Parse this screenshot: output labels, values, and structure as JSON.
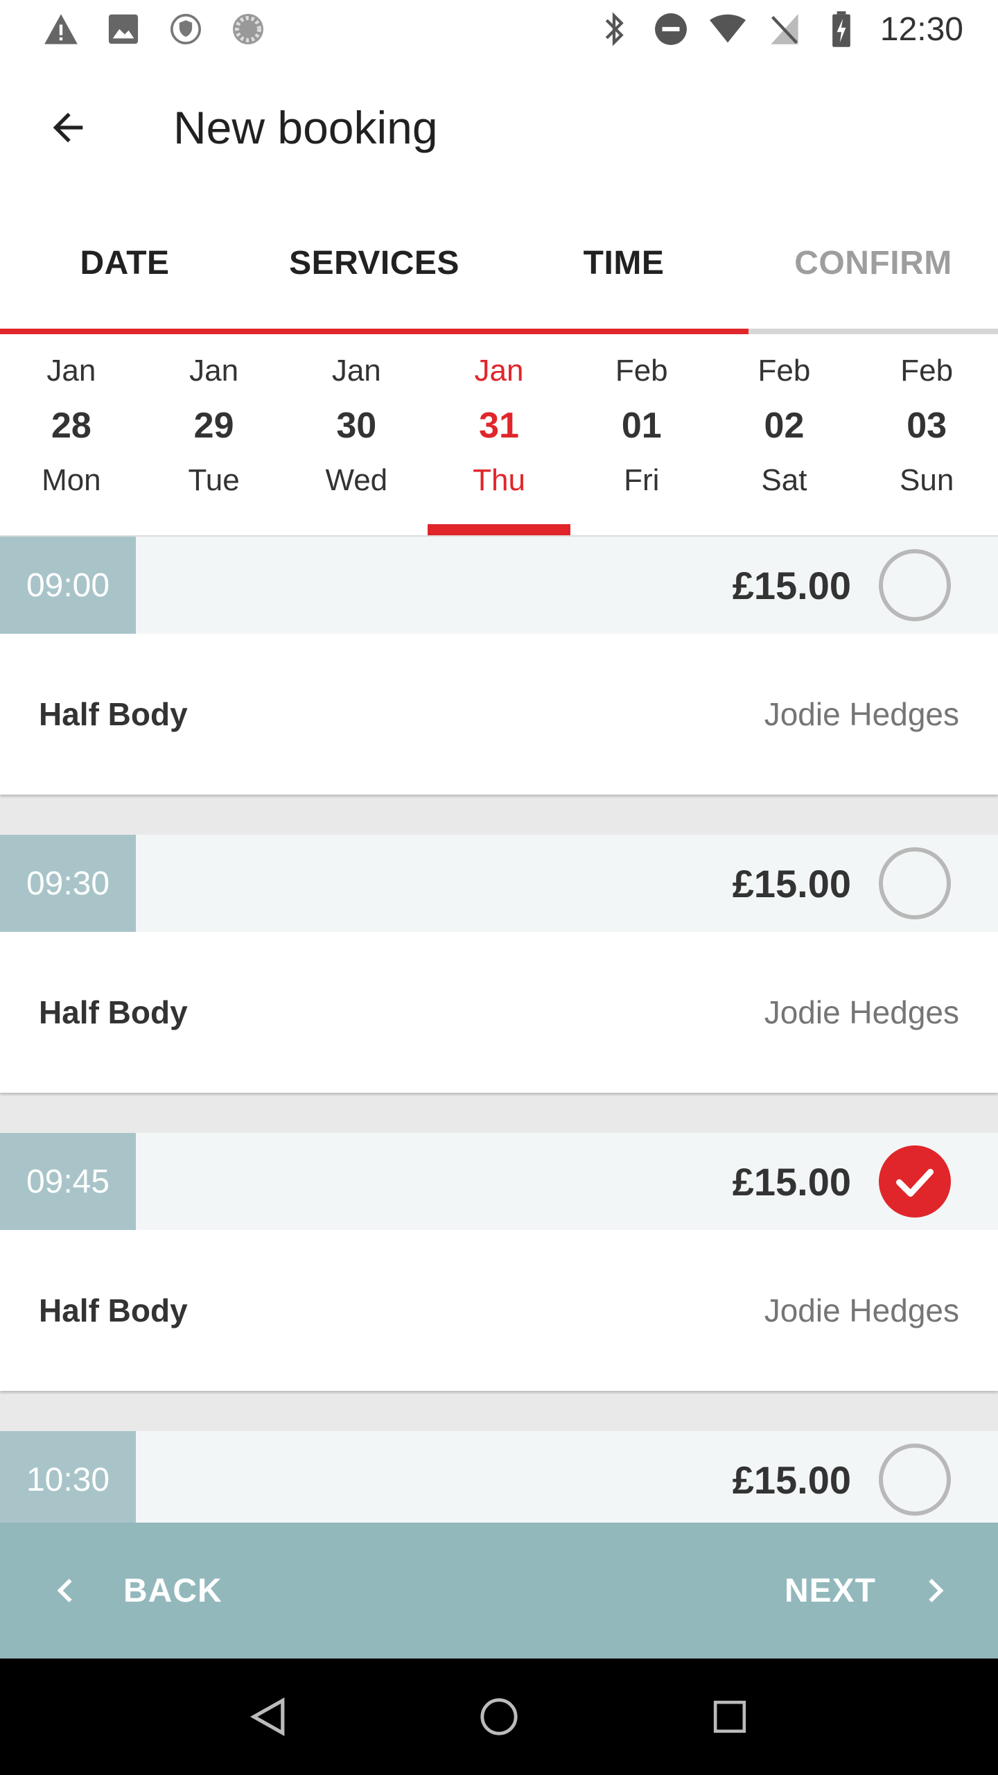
{
  "status_bar": {
    "time": "12:30",
    "left_icons": [
      "warning-icon",
      "image-icon",
      "vpn-shield-icon",
      "loading-icon"
    ],
    "right_icons": [
      "bluetooth-icon",
      "do-not-disturb-icon",
      "wifi-icon",
      "no-sim-icon",
      "battery-charging-icon"
    ]
  },
  "app_bar": {
    "title": "New booking",
    "back_icon": "arrow-back-icon"
  },
  "steps": [
    {
      "label": "DATE",
      "state": "done"
    },
    {
      "label": "SERVICES",
      "state": "done"
    },
    {
      "label": "TIME",
      "state": "active"
    },
    {
      "label": "CONFIRM",
      "state": "inactive"
    }
  ],
  "progress": {
    "fraction": 0.75,
    "color": "#e0262a"
  },
  "dates": [
    {
      "month": "Jan",
      "day": "28",
      "weekday": "Mon",
      "selected": false
    },
    {
      "month": "Jan",
      "day": "29",
      "weekday": "Tue",
      "selected": false
    },
    {
      "month": "Jan",
      "day": "30",
      "weekday": "Wed",
      "selected": false
    },
    {
      "month": "Jan",
      "day": "31",
      "weekday": "Thu",
      "selected": true
    },
    {
      "month": "Feb",
      "day": "01",
      "weekday": "Fri",
      "selected": false
    },
    {
      "month": "Feb",
      "day": "02",
      "weekday": "Sat",
      "selected": false
    },
    {
      "month": "Feb",
      "day": "03",
      "weekday": "Sun",
      "selected": false
    }
  ],
  "slots": [
    {
      "time": "09:00",
      "price": "£15.00",
      "service": "Half Body",
      "staff": "Jodie Hedges",
      "selected": false
    },
    {
      "time": "09:30",
      "price": "£15.00",
      "service": "Half Body",
      "staff": "Jodie Hedges",
      "selected": false
    },
    {
      "time": "09:45",
      "price": "£15.00",
      "service": "Half Body",
      "staff": "Jodie Hedges",
      "selected": true
    },
    {
      "time": "10:30",
      "price": "£15.00",
      "service": "",
      "staff": "",
      "selected": false
    }
  ],
  "bottom_bar": {
    "back_label": "BACK",
    "next_label": "NEXT"
  },
  "colors": {
    "accent": "#e0262a",
    "bottom_bar": "#92b8bc",
    "time_chip": "#a8c4c8"
  }
}
